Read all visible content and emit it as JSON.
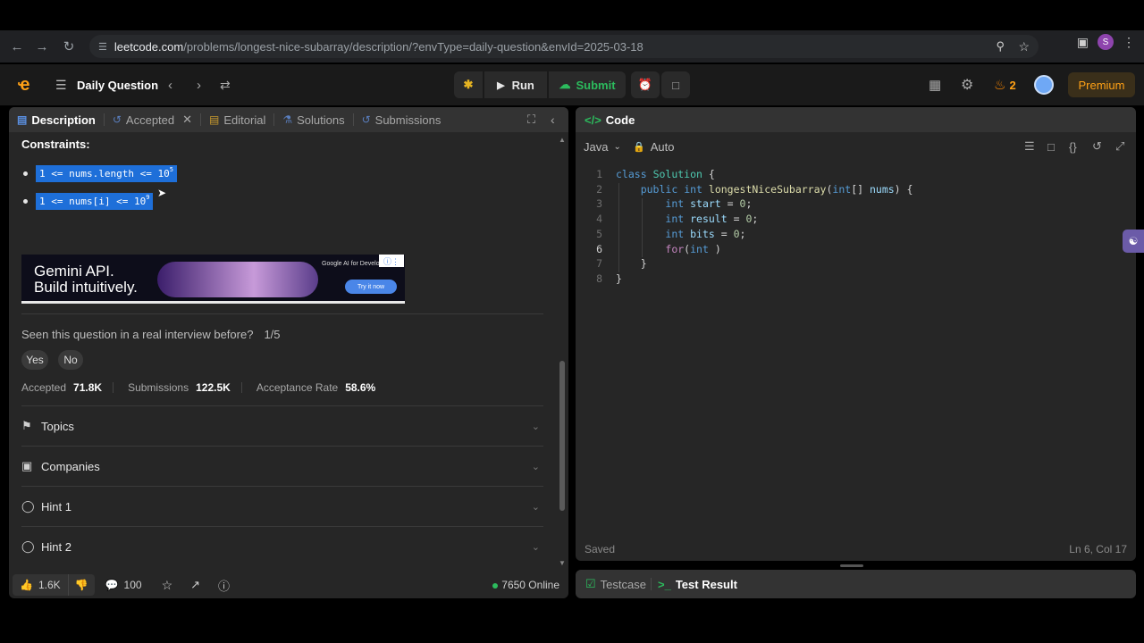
{
  "browser": {
    "url_host": "leetcode.com",
    "url_path": "/problems/longest-nice-subarray/description/?envType=daily-question&envId=2025-03-18",
    "profile_initial": "S"
  },
  "topnav": {
    "title": "Daily Question",
    "run_label": "Run",
    "submit_label": "Submit",
    "streak_count": "2",
    "premium_label": "Premium"
  },
  "left": {
    "tabs": [
      "Description",
      "Accepted",
      "Editorial",
      "Solutions",
      "Submissions"
    ],
    "constraints_title": "Constraints:",
    "constraint1": {
      "text": "1 <= nums.length <= 10",
      "exp": "5"
    },
    "constraint2": {
      "text": "1 <= nums[i] <= 10",
      "exp": "9"
    },
    "ad": {
      "line1": "Gemini API.",
      "line2": "Build intuitively.",
      "brand": "Google AI for Developers",
      "cta": "Try it now"
    },
    "seen_question": "Seen this question in a real interview before?",
    "seen_count": "1/5",
    "yes_label": "Yes",
    "no_label": "No",
    "stats": {
      "accepted_label": "Accepted",
      "accepted_value": "71.8K",
      "submissions_label": "Submissions",
      "submissions_value": "122.5K",
      "rate_label": "Acceptance Rate",
      "rate_value": "58.6%"
    },
    "sections": [
      "Topics",
      "Companies",
      "Hint 1",
      "Hint 2"
    ],
    "bottom": {
      "likes": "1.6K",
      "comments": "100",
      "online": "7650 Online"
    }
  },
  "code": {
    "title": "Code",
    "language": "Java",
    "mode": "Auto",
    "line_numbers": [
      "1",
      "2",
      "3",
      "4",
      "5",
      "6",
      "7",
      "8"
    ],
    "status": "Saved",
    "cursor": "Ln 6, Col 17"
  },
  "testpanel": {
    "testcase_label": "Testcase",
    "result_label": "Test Result"
  },
  "colors": {
    "accent_orange": "#ffa116",
    "submit_green": "#2cbb5d",
    "highlight_blue": "#1e6fd9"
  }
}
